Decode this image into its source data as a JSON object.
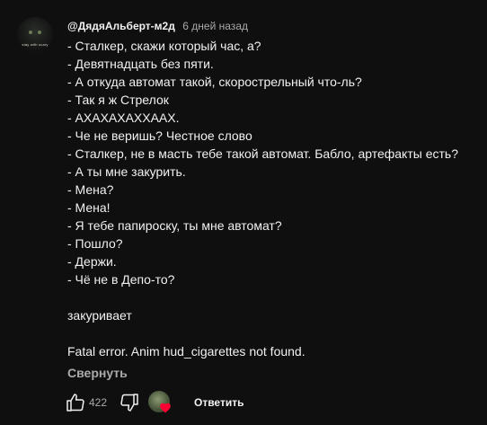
{
  "comment": {
    "author": "@ДядяАльберт-м2д",
    "time_ago": "6 дней назад",
    "avatar_caption": "stay with scary",
    "lines": [
      "- Сталкер, скажи который час, а?",
      "- Девятнадцать без пяти.",
      "- А откуда автомат такой, скорострельный что-ль?",
      "- Так я ж Стрелок",
      "- АХАХАХАХХААХ.",
      "- Че не веришь? Честное слово",
      "- Сталкер, не в масть тебе такой автомат. Бабло, артефакты есть?",
      "- А ты мне закурить.",
      "- Мена?",
      "- Мена!",
      "- Я тебе папироску, ты мне автомат?",
      "- Пошло?",
      "- Держи.",
      "- Чё не в Депо-то?"
    ],
    "action_line": "закуривает",
    "error_line": "Fatal error. Anim hud_cigarettes not found.",
    "collapse_label": "Свернуть"
  },
  "actions": {
    "like_count": "422",
    "reply_label": "Ответить"
  },
  "colors": {
    "background": "#0f0f0f",
    "text_primary": "#f1f1f1",
    "text_secondary": "#aaaaaa",
    "heart": "#ff0033"
  },
  "icons": {
    "like": "thumbs-up-icon",
    "dislike": "thumbs-down-icon",
    "heart": "heart-icon"
  }
}
